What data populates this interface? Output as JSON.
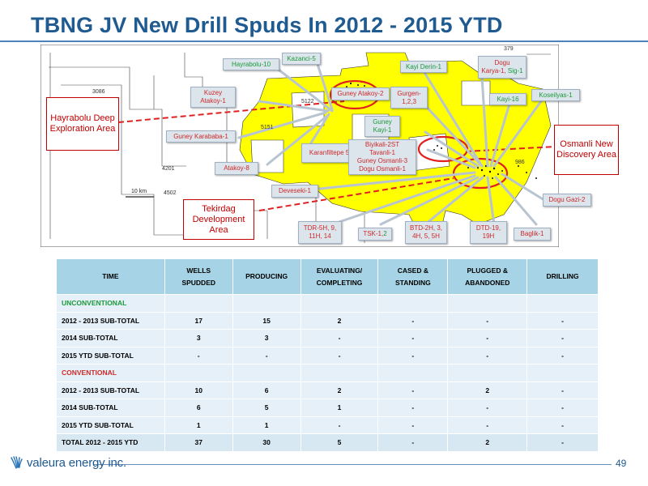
{
  "slide": {
    "title": "TBNG JV New Drill Spuds In 2012 - 2015 YTD",
    "page_number": "49",
    "logo_text": "valeura energy inc."
  },
  "map": {
    "numbers": {
      "n379": "379",
      "n3086": "3086",
      "n5122": "5122",
      "n5151": "5151",
      "n4201": "4201",
      "n4502": "4502",
      "n986": "986"
    },
    "scale_label": "10 km",
    "areas": {
      "hayrabolu": "Hayrabolu Deep Exploration Area",
      "osmanli": "Osmanli New Discovery Area",
      "tekirdag": "Tekirdag Development Area"
    },
    "callouts": {
      "hayrabolu10": "Hayrabolu-10",
      "kazanci5": "Kazanci-5",
      "kayiderin1": "Kayi Derin-1",
      "dogu_a": "Dogu",
      "dogu_b": "Karya-1, ",
      "dogu_c": "Sig-1",
      "kuzey_a": "Kuzey",
      "kuzey_b": "Atakoy-1",
      "guneyatakoy2": "Guney Atakoy-2",
      "gurgen_a": "Gurgen-",
      "gurgen_b": "1,2,3",
      "kayi16": "Kayi-16",
      "koseilyas1": "Koseilyas-1",
      "guneykayi_a": "Guney",
      "guneykayi_b": "Kayi-1",
      "guneykarababa1": "Guney Karababa-1",
      "karanfiltepe": "Karanfiltepe 5, 6",
      "biyikali_a": "Biyikali-2ST",
      "biyikali_b": "Tavanli-1",
      "biyikali_c": "Guney Osmanli-3",
      "biyikali_d": "Dogu Osmanli-1",
      "atakoy8": "Atakoy-8",
      "deveseki1": "Deveseki-1",
      "dogugazi2": "Dogu Gazi-2",
      "tdr_a": "TDR-5H, 9,",
      "tdr_b": "11H, 14",
      "tsk_a": "TSK-1, ",
      "tsk_b": "2",
      "btd_a": "BTD-2H, 3,",
      "btd_b": "4H, 5, 5H",
      "dtd_a": "DTD-19,",
      "dtd_b": "19H",
      "baglik1": "Baglik-1"
    }
  },
  "table": {
    "headers": {
      "time": "TIME",
      "wells": "WELLS SPUDDED",
      "producing": "PRODUCING",
      "evaluating": "EVALUATING/ COMPLETING",
      "cased": "CASED & STANDING",
      "plugged": "PLUGGED & ABANDONED",
      "drilling": "DRILLING"
    },
    "sections": {
      "unconventional": "UNCONVENTIONAL",
      "conventional": "CONVENTIONAL"
    },
    "rows": {
      "u1": [
        "2012 - 2013 SUB-TOTAL",
        "17",
        "15",
        "2",
        "-",
        "-",
        "-"
      ],
      "u2": [
        "2014 SUB-TOTAL",
        "3",
        "3",
        "-",
        "-",
        "-",
        "-"
      ],
      "u3": [
        "2015 YTD  SUB-TOTAL",
        "-",
        "-",
        "-",
        "-",
        "-",
        "-"
      ],
      "c1": [
        "2012 - 2013 SUB-TOTAL",
        "10",
        "6",
        "2",
        "-",
        "2",
        "-"
      ],
      "c2": [
        "2014 SUB-TOTAL",
        "6",
        "5",
        "1",
        "-",
        "-",
        "-"
      ],
      "c3": [
        "2015 YTD SUB-TOTAL",
        "1",
        "1",
        "-",
        "-",
        "-",
        "-"
      ],
      "total": [
        "TOTAL 2012 - 2015 YTD",
        "37",
        "30",
        "5",
        "-",
        "2",
        "-"
      ]
    }
  },
  "colors": {
    "title_blue": "#1f5a91",
    "header_cyan": "#a6d4e6",
    "cell_light": "#e6f0f8",
    "map_yellow": "#ffff00",
    "highlight_red": "#e02020",
    "green_text": "#1a9a3a"
  }
}
